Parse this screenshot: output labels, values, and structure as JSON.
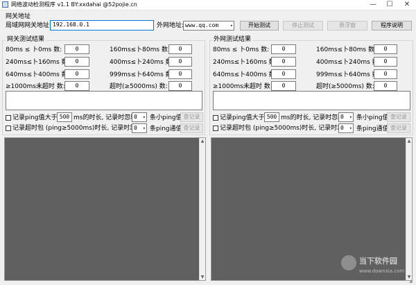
{
  "window": {
    "title": "网络波动检测程序 v1.1  BY:xxdahai  @52pojie.cn",
    "min_glyph": "—",
    "max_glyph": "☐",
    "close_glyph": "✕"
  },
  "gateway": {
    "section_label": "网关地址",
    "lan_label": "局域网网关地址:",
    "lan_value": "192.168.0.1",
    "wan_label": "外网地址:",
    "wan_value": "www.qq.com"
  },
  "toolbar": {
    "start": "开始测试",
    "stop": "停止测试",
    "hover": "悬浮窗",
    "help": "程序说明"
  },
  "stats_left": {
    "title": "网关测试结果",
    "rows": [
      {
        "l_label": "80ms ≤ 卜0ms  数:",
        "l_value": "0",
        "r_label": "160ms≤卜80ms  数:",
        "r_value": "0"
      },
      {
        "l_label": "240ms≤卜160ms 数:",
        "l_value": "0",
        "r_label": "400ms≤卜240ms 数:",
        "r_value": "0"
      },
      {
        "l_label": "640ms≤卜400ms 数:",
        "l_value": "0",
        "r_label": "999ms≤卜640ms 数:",
        "r_value": "0"
      },
      {
        "l_label": "≥1000ms未超时 数:",
        "l_value": "0",
        "r_label": "超时(≥5000ms) 数:",
        "r_value": "0"
      }
    ]
  },
  "stats_right": {
    "title": "外网测试结果",
    "rows": [
      {
        "l_label": "80ms ≤ 卜0ms  数:",
        "l_value": "0",
        "r_label": "160ms≤卜80ms  数:",
        "r_value": "0"
      },
      {
        "l_label": "240ms≤卜160ms 数:",
        "l_value": "0",
        "r_label": "400ms≤卜240ms 数:",
        "r_value": "0"
      },
      {
        "l_label": "640ms≤卜400ms 数:",
        "l_value": "0",
        "r_label": "999ms≤卜640ms 数:",
        "r_value": "0"
      },
      {
        "l_label": "≥1000ms未超时 数:",
        "l_value": "0",
        "r_label": "超时(≥5000ms) 数:",
        "r_value": "0"
      }
    ]
  },
  "record_left": {
    "ping_label": "记录ping值大于:",
    "ping_value": "500",
    "ping_suffix": "ms的时长, 记录时忽略",
    "ignore1": "0",
    "ignore1_suffix": "条小ping值",
    "view1": "查记录",
    "timeout_label": "记录超时包 (ping≥5000ms)时长, 记录时忽略",
    "ignore2": "0",
    "ignore2_suffix": "条ping通值",
    "view2": "查记录"
  },
  "record_right": {
    "ping_label": "记录ping值大于:",
    "ping_value": "500",
    "ping_suffix": "ms的时长, 记录时忽略",
    "ignore1": "0",
    "ignore1_suffix": "条小ping值",
    "view1": "查记录",
    "timeout_label": "记录超时包 (ping≥5000ms)时长, 记录时忽略",
    "ignore2": "0",
    "ignore2_suffix": "条ping通值",
    "view2": "查记录"
  },
  "watermark": {
    "brand": "当下软件园",
    "url": "www.downxia.com"
  },
  "colors": {
    "log_panel": "#606060",
    "focus_border": "#0078d7"
  }
}
